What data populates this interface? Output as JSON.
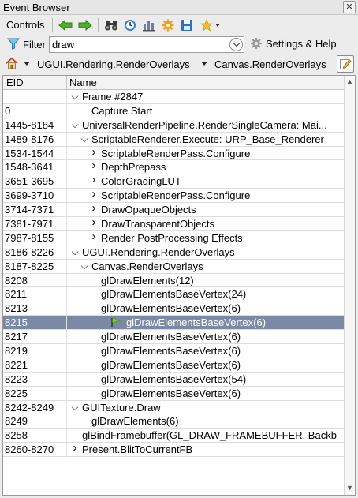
{
  "window": {
    "title": "Event Browser",
    "close_label": "✕"
  },
  "toolbar": {
    "label": "Controls"
  },
  "filter": {
    "label": "Filter",
    "value": "draw",
    "settings_label": "Settings & Help"
  },
  "breadcrumb": {
    "items": [
      "UGUI.Rendering.RenderOverlays",
      "Canvas.RenderOverlays"
    ]
  },
  "table": {
    "columns": [
      "EID",
      "Name"
    ],
    "rows": [
      {
        "eid": "",
        "name": "Frame #2847",
        "indent": 0,
        "expander": "open"
      },
      {
        "eid": "0",
        "name": "Capture Start",
        "indent": 1,
        "expander": ""
      },
      {
        "eid": "1445-8184",
        "name": "UniversalRenderPipeline.RenderSingleCamera: Mai...",
        "indent": 0,
        "expander": "open"
      },
      {
        "eid": "1489-8176",
        "name": "ScriptableRenderer.Execute: URP_Base_Renderer",
        "indent": 1,
        "expander": "open"
      },
      {
        "eid": "1534-1544",
        "name": "ScriptableRenderPass.Configure",
        "indent": 2,
        "expander": "closed"
      },
      {
        "eid": "1548-3641",
        "name": "DepthPrepass",
        "indent": 2,
        "expander": "closed"
      },
      {
        "eid": "3651-3695",
        "name": "ColorGradingLUT",
        "indent": 2,
        "expander": "closed"
      },
      {
        "eid": "3699-3710",
        "name": "ScriptableRenderPass.Configure",
        "indent": 2,
        "expander": "closed"
      },
      {
        "eid": "3714-7371",
        "name": "DrawOpaqueObjects",
        "indent": 2,
        "expander": "closed"
      },
      {
        "eid": "7381-7971",
        "name": "DrawTransparentObjects",
        "indent": 2,
        "expander": "closed"
      },
      {
        "eid": "7987-8155",
        "name": "Render PostProcessing Effects",
        "indent": 2,
        "expander": "closed"
      },
      {
        "eid": "8186-8226",
        "name": "UGUI.Rendering.RenderOverlays",
        "indent": 0,
        "expander": "open"
      },
      {
        "eid": "8187-8225",
        "name": "Canvas.RenderOverlays",
        "indent": 1,
        "expander": "open"
      },
      {
        "eid": "8208",
        "name": "glDrawElements(12)",
        "indent": 2,
        "expander": ""
      },
      {
        "eid": "8211",
        "name": "glDrawElementsBaseVertex(24)",
        "indent": 2,
        "expander": ""
      },
      {
        "eid": "8213",
        "name": "glDrawElementsBaseVertex(6)",
        "indent": 2,
        "expander": ""
      },
      {
        "eid": "8215",
        "name": "glDrawElementsBaseVertex(6)",
        "indent": 2,
        "expander": "",
        "selected": true,
        "flag": true
      },
      {
        "eid": "8217",
        "name": "glDrawElementsBaseVertex(6)",
        "indent": 2,
        "expander": ""
      },
      {
        "eid": "8219",
        "name": "glDrawElementsBaseVertex(6)",
        "indent": 2,
        "expander": ""
      },
      {
        "eid": "8221",
        "name": "glDrawElementsBaseVertex(6)",
        "indent": 2,
        "expander": ""
      },
      {
        "eid": "8223",
        "name": "glDrawElementsBaseVertex(54)",
        "indent": 2,
        "expander": ""
      },
      {
        "eid": "8225",
        "name": "glDrawElementsBaseVertex(6)",
        "indent": 2,
        "expander": ""
      },
      {
        "eid": "8242-8249",
        "name": "GUITexture.Draw",
        "indent": 0,
        "expander": "open"
      },
      {
        "eid": "8249",
        "name": "glDrawElements(6)",
        "indent": 1,
        "expander": ""
      },
      {
        "eid": "8258",
        "name": "glBindFramebuffer(GL_DRAW_FRAMEBUFFER, Backb",
        "indent": 0,
        "expander": ""
      },
      {
        "eid": "8260-8270",
        "name": "Present.BlitToCurrentFB",
        "indent": 0,
        "expander": "closed"
      }
    ]
  },
  "colors": {
    "selection": "#7b8aa4",
    "arrow_green": "#4caf2a",
    "binoculars": "#3a3a3a",
    "timer_blue": "#2f7fd6",
    "gear_orange": "#f0a020",
    "save_blue": "#2b6fc9"
  },
  "icons": [
    "arrow-left-icon",
    "arrow-right-icon",
    "binoculars-icon",
    "timer-icon",
    "statistics-icon",
    "gear-icon",
    "save-icon",
    "bookmark-icon",
    "filter-icon",
    "settings-icon",
    "home-icon",
    "edit-icon",
    "flag-icon"
  ]
}
